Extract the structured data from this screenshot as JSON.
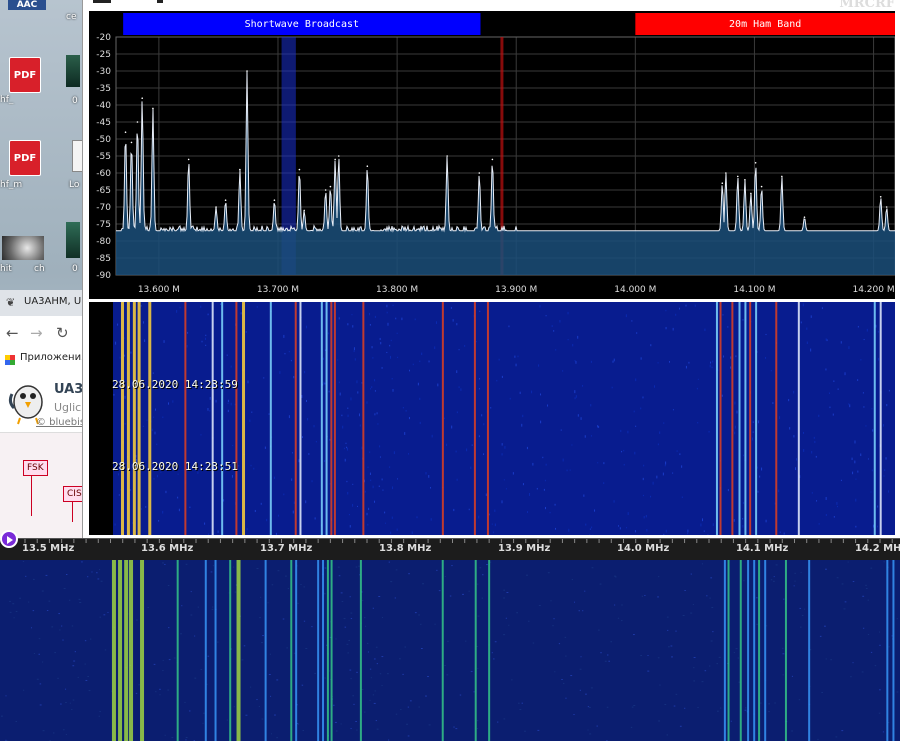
{
  "desktop": {
    "top_label": "AAC",
    "items": [
      {
        "label": "ce"
      },
      {
        "label": "hf_"
      },
      {
        "label": "0"
      },
      {
        "label": "hf_m"
      },
      {
        "label": "Lo"
      },
      {
        "label": "hit"
      },
      {
        "label": "ch"
      },
      {
        "label": "0"
      }
    ],
    "pdf_text": "PDF"
  },
  "browser": {
    "tab_title": "UA3AHM, U",
    "bookmarks_label": "Приложения",
    "site_title": "UA3",
    "site_sub": "Uglic",
    "site_link": "© bluebis",
    "tags": [
      "FSK",
      "CIS"
    ]
  },
  "sdr": {
    "brand": "MRCRF",
    "bands": [
      {
        "label": "Shortwave Broadcast",
        "color": "#0000ff"
      },
      {
        "label": "20m Ham Band",
        "color": "#ff0000"
      }
    ],
    "y_ticks": [
      "-20",
      "-25",
      "-30",
      "-35",
      "-40",
      "-45",
      "-50",
      "-55",
      "-60",
      "-65",
      "-70",
      "-75",
      "-80",
      "-85",
      "-90"
    ],
    "x_ticks": [
      "13.600 M",
      "13.700 M",
      "13.800 M",
      "13.900 M",
      "14.000 M",
      "14.100 M",
      "14.200 M"
    ],
    "timestamps": [
      "28.06.2020 14:23:59",
      "28.06.2020 14:23:51"
    ]
  },
  "freqbar": {
    "ticks": [
      "13.5 MHz",
      "13.6 MHz",
      "13.7 MHz",
      "13.8 MHz",
      "13.9 MHz",
      "14.0 MHz",
      "14.1 MHz",
      "14.2 MHz"
    ]
  },
  "chart_data": {
    "type": "line",
    "xlabel": "",
    "ylabel": "",
    "xlim": [
      13.564,
      14.218
    ],
    "ylim": [
      -90,
      -20
    ],
    "noise_floor": -77,
    "peaks": [
      {
        "x": 13.572,
        "y": -48
      },
      {
        "x": 13.577,
        "y": -51
      },
      {
        "x": 13.582,
        "y": -45
      },
      {
        "x": 13.586,
        "y": -38
      },
      {
        "x": 13.595,
        "y": -41
      },
      {
        "x": 13.625,
        "y": -56
      },
      {
        "x": 13.648,
        "y": -70
      },
      {
        "x": 13.656,
        "y": -68
      },
      {
        "x": 13.668,
        "y": -59
      },
      {
        "x": 13.674,
        "y": -30
      },
      {
        "x": 13.697,
        "y": -68
      },
      {
        "x": 13.718,
        "y": -59
      },
      {
        "x": 13.722,
        "y": -71
      },
      {
        "x": 13.74,
        "y": -65
      },
      {
        "x": 13.744,
        "y": -64
      },
      {
        "x": 13.748,
        "y": -56
      },
      {
        "x": 13.751,
        "y": -55
      },
      {
        "x": 13.775,
        "y": -58
      },
      {
        "x": 13.842,
        "y": -55
      },
      {
        "x": 13.869,
        "y": -60
      },
      {
        "x": 13.88,
        "y": -56
      },
      {
        "x": 14.073,
        "y": -63
      },
      {
        "x": 14.076,
        "y": -60
      },
      {
        "x": 14.086,
        "y": -61
      },
      {
        "x": 14.092,
        "y": -62
      },
      {
        "x": 14.097,
        "y": -66
      },
      {
        "x": 14.101,
        "y": -57
      },
      {
        "x": 14.106,
        "y": -64
      },
      {
        "x": 14.123,
        "y": -61
      },
      {
        "x": 14.142,
        "y": -73
      },
      {
        "x": 14.206,
        "y": -67
      },
      {
        "x": 14.211,
        "y": -70
      }
    ]
  }
}
